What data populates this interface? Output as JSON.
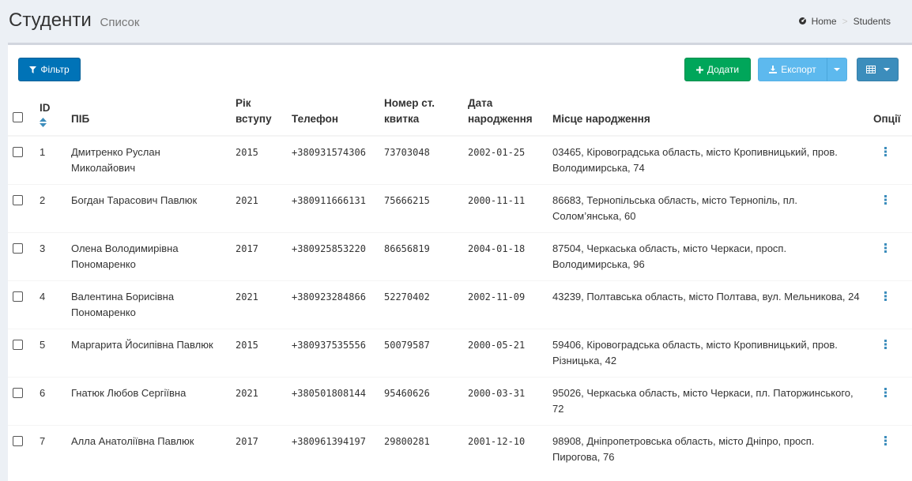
{
  "header": {
    "title": "Студенти",
    "subtitle": "Список",
    "breadcrumb": {
      "home": "Home",
      "current": "Students"
    }
  },
  "toolbar": {
    "filter_label": "Фільтр",
    "add_label": "Додати",
    "export_label": "Експорт"
  },
  "colors": {
    "filter": "#0073b7",
    "add": "#00a65a",
    "export": "#5db9ee",
    "columns": "#3c8dbc",
    "sort": "#3c8dbc",
    "options": "#3c8dbc"
  },
  "table": {
    "headers": {
      "id": "ID",
      "name": "ПІБ",
      "year": "Рік вступу",
      "phone": "Телефон",
      "ticket": "Номер ст. квитка",
      "birth_date": "Дата народження",
      "birth_place": "Місце народження",
      "options": "Опції"
    },
    "rows": [
      {
        "id": "1",
        "name": "Дмитренко Руслан Миколайович",
        "year": "2015",
        "phone": "+380931574306",
        "ticket": "73703048",
        "birth_date": "2002-01-25",
        "birth_place": "03465, Кіровоградська область, місто Кропивницький, пров. Володимирська, 74"
      },
      {
        "id": "2",
        "name": "Богдан Тарасович Павлюк",
        "year": "2021",
        "phone": "+380911666131",
        "ticket": "75666215",
        "birth_date": "2000-11-11",
        "birth_place": "86683, Тернопільська область, місто Тернопіль, пл. Солом’янська, 60"
      },
      {
        "id": "3",
        "name": "Олена Володимирівна Пономаренко",
        "year": "2017",
        "phone": "+380925853220",
        "ticket": "86656819",
        "birth_date": "2004-01-18",
        "birth_place": "87504, Черкаська область, місто Черкаси, просп. Володимирська, 96"
      },
      {
        "id": "4",
        "name": "Валентина Борисівна Пономаренко",
        "year": "2021",
        "phone": "+380923284866",
        "ticket": "52270402",
        "birth_date": "2002-11-09",
        "birth_place": "43239, Полтавська область, місто Полтава, вул. Мельникова, 24"
      },
      {
        "id": "5",
        "name": "Маргарита Йосипівна Павлюк",
        "year": "2015",
        "phone": "+380937535556",
        "ticket": "50079587",
        "birth_date": "2000-05-21",
        "birth_place": "59406, Кіровоградська область, місто Кропивницький, пров. Різницька, 42"
      },
      {
        "id": "6",
        "name": "Гнатюк Любов Сергіївна",
        "year": "2021",
        "phone": "+380501808144",
        "ticket": "95460626",
        "birth_date": "2000-03-31",
        "birth_place": "95026, Черкаська область, місто Черкаси, пл. Паторжинського, 72"
      },
      {
        "id": "7",
        "name": "Алла Анатоліївна Павлюк",
        "year": "2017",
        "phone": "+380961394197",
        "ticket": "29800281",
        "birth_date": "2001-12-10",
        "birth_place": "98908, Дніпропетровська область, місто Дніпро, просп. Пирогова, 76"
      }
    ]
  }
}
